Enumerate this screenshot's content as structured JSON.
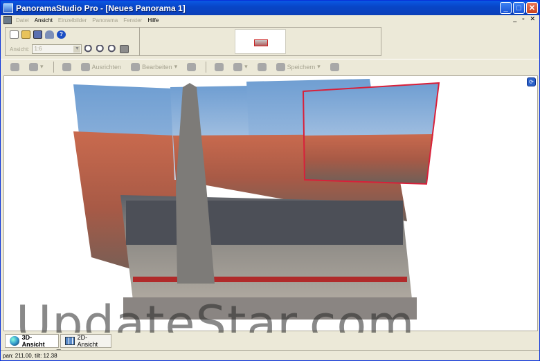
{
  "window": {
    "title": "PanoramaStudio Pro - [Neues Panorama 1]",
    "minimize": "_",
    "maximize": "□",
    "close": "✕"
  },
  "menu": {
    "items": [
      {
        "label": "Datei",
        "disabled": true
      },
      {
        "label": "Ansicht",
        "disabled": false
      },
      {
        "label": "Einzelbilder",
        "disabled": true
      },
      {
        "label": "Panorama",
        "disabled": true
      },
      {
        "label": "Fenster",
        "disabled": true
      },
      {
        "label": "Hilfe",
        "disabled": false
      }
    ],
    "mdi": {
      "minimize": "_",
      "restore": "▫",
      "close": "✕"
    }
  },
  "panel": {
    "view_label": "Ansicht:",
    "view_value": "1:6"
  },
  "toolbar": {
    "align_label": "Ausrichten",
    "edit_label": "Bearbeiten",
    "save_label": "Speichern"
  },
  "tabs": [
    {
      "label": "3D-Ansicht",
      "active": true
    },
    {
      "label": "2D-Ansicht",
      "active": false
    }
  ],
  "status": "pan: 211.00, tilt: 12.38",
  "watermark": "UpdateStar.com",
  "colors": {
    "titlebar": "#0846c8",
    "selection": "#d8203a"
  }
}
